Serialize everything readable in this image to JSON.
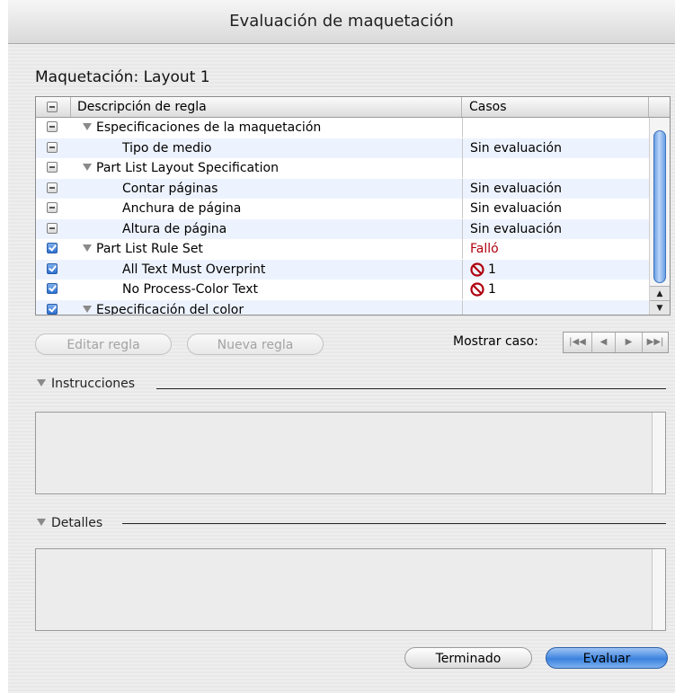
{
  "window": {
    "title": "Evaluación de maquetación"
  },
  "layout_title": "Maquetación: Layout 1",
  "table": {
    "headers": {
      "description": "Descripción de regla",
      "cases": "Casos"
    },
    "rows": [
      {
        "check": "mixed",
        "expander": true,
        "indent": false,
        "description": "Especificaciones de la maquetación",
        "cases": "",
        "fail": false
      },
      {
        "check": "mixed",
        "expander": false,
        "indent": true,
        "description": "Tipo de medio",
        "cases": "Sin evaluación",
        "fail": false
      },
      {
        "check": "mixed",
        "expander": true,
        "indent": false,
        "description": "Part List Layout Specification",
        "cases": "",
        "fail": false
      },
      {
        "check": "mixed",
        "expander": false,
        "indent": true,
        "description": "Contar páginas",
        "cases": "Sin evaluación",
        "fail": false
      },
      {
        "check": "mixed",
        "expander": false,
        "indent": true,
        "description": "Anchura de página",
        "cases": "Sin evaluación",
        "fail": false
      },
      {
        "check": "mixed",
        "expander": false,
        "indent": true,
        "description": "Altura de página",
        "cases": "Sin evaluación",
        "fail": false
      },
      {
        "check": "checked",
        "expander": true,
        "indent": false,
        "description": "Part List Rule Set",
        "cases": "Falló",
        "fail": true
      },
      {
        "check": "checked",
        "expander": false,
        "indent": true,
        "description": "All Text Must Overprint",
        "cases": "1",
        "fail": false,
        "icon": "prohibited-icon"
      },
      {
        "check": "checked",
        "expander": false,
        "indent": true,
        "description": "No Process-Color Text",
        "cases": "1",
        "fail": false,
        "icon": "prohibited-icon"
      },
      {
        "check": "checked",
        "expander": true,
        "indent": false,
        "description": "Especificación del color",
        "cases": "",
        "fail": false
      }
    ]
  },
  "buttons": {
    "edit_rule": "Editar regla",
    "new_rule": "Nueva regla",
    "done": "Terminado",
    "evaluate": "Evaluar"
  },
  "show_case": {
    "label": "Mostrar caso:",
    "nav_icons": [
      "first-icon",
      "previous-icon",
      "next-icon",
      "last-icon"
    ]
  },
  "sections": {
    "instructions": "Instrucciones",
    "details": "Detalles"
  },
  "colors": {
    "fail_text": "#b0000f",
    "accent_blue": "#3b82de"
  }
}
